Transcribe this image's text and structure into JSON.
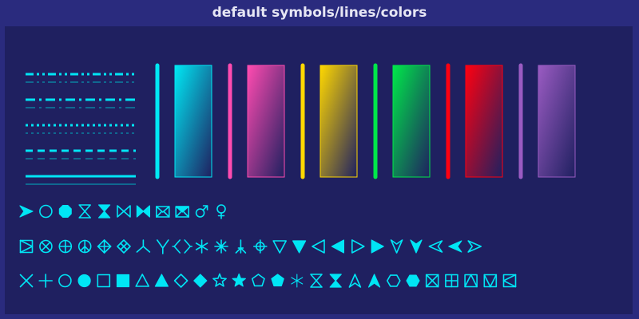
{
  "title": "default symbols/lines/colors",
  "colors": {
    "page_bg": "#2a2b7e",
    "panel_bg": "#1f2060",
    "title_text": "#e6e6f4",
    "symbol": "#00e5f5",
    "line_main": "#00e5f5",
    "line_thin": "#00b0c0"
  },
  "line_styles": [
    "dash-dot-dot",
    "dash-dot",
    "dot",
    "dash",
    "solid"
  ],
  "swatches": [
    {
      "name": "cyan",
      "color": "#00e8f4"
    },
    {
      "name": "pink",
      "color": "#ff4bb0"
    },
    {
      "name": "yellow",
      "color": "#ffd800"
    },
    {
      "name": "green",
      "color": "#00e84a"
    },
    {
      "name": "red",
      "color": "#ff0010"
    },
    {
      "name": "purple",
      "color": "#9a5bc2"
    }
  ],
  "symbol_rows": [
    [
      "arrowhead-right-icon",
      "circle-icon",
      "octagon-icon",
      "hourglass-outline-icon",
      "hourglass-filled-icon",
      "bowtie-outline-icon",
      "bowtie-filled-icon",
      "envelope-outline-icon",
      "envelope-filled-icon",
      "male-icon",
      "female-icon"
    ],
    [
      "square-triangle-icon",
      "circle-x-icon",
      "circle-plus-icon",
      "peace-icon",
      "diamond-plus-icon",
      "diamond-x-icon",
      "tri-down-thin-icon",
      "tri-down-thick-icon",
      "arrows-apart-icon",
      "asterisk-six-icon",
      "asterisk-eight-icon",
      "tri-up-bar-icon",
      "circle-plus-big-icon",
      "triangle-down-icon",
      "triangle-down-filled-icon",
      "triangle-left-icon",
      "triangle-left-filled-icon",
      "triangle-right-icon",
      "triangle-right-filled-icon",
      "arrowhead-down-icon",
      "arrowhead-down-filled-icon",
      "arrowhead-left-icon",
      "arrowhead-left-filled-icon",
      "arrowhead-right-outline-icon"
    ],
    [
      "cross-icon",
      "plus-icon",
      "circle-icon",
      "circle-filled-icon",
      "square-icon",
      "square-filled-icon",
      "triangle-up-icon",
      "triangle-up-filled-icon",
      "diamond-icon",
      "diamond-filled-icon",
      "star-icon",
      "star-filled-icon",
      "pentagon-icon",
      "pentagon-filled-icon",
      "asterisk-thin-icon",
      "hourglass-outline-icon",
      "hourglass-filled-icon",
      "arrowhead-up-icon",
      "arrowhead-up-filled-icon",
      "hexagon-icon",
      "hexagon-filled-icon",
      "square-x-icon",
      "square-plus-icon",
      "square-tri-up-icon",
      "square-tri-down-icon",
      "square-tri-left-icon"
    ]
  ]
}
